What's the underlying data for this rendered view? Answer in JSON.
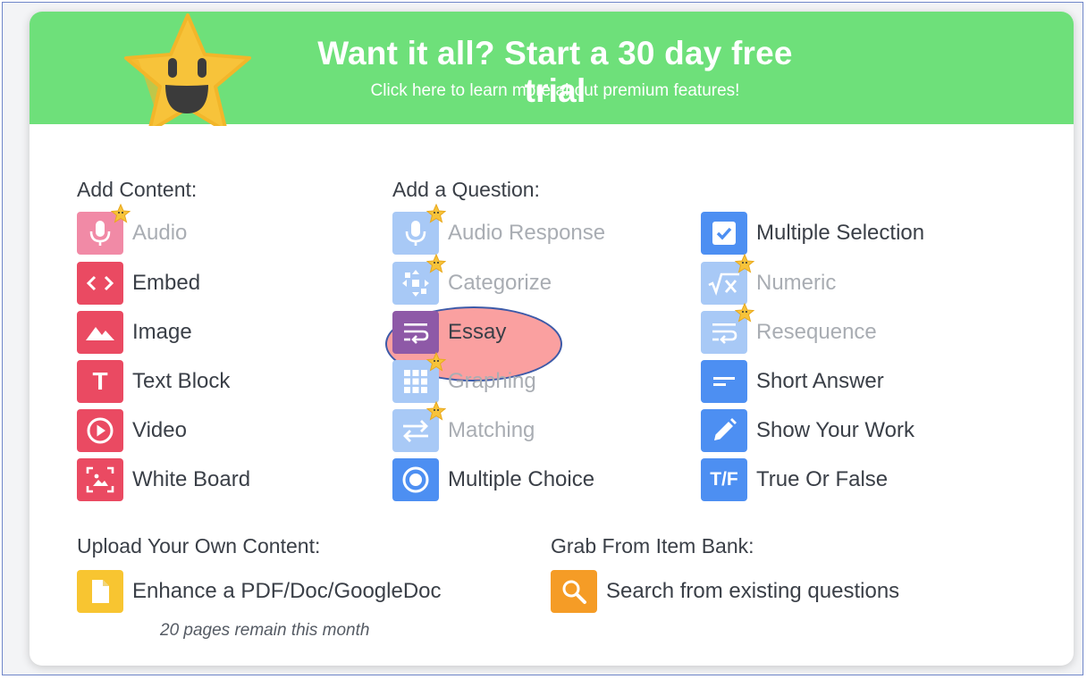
{
  "banner": {
    "title": "Want it all? Start a 30 day free trial",
    "subtitle": "Click here to learn more about premium features!"
  },
  "sections": {
    "add_content": "Add Content:",
    "add_question": "Add a Question:",
    "upload": "Upload Your Own Content:",
    "item_bank": "Grab From Item Bank:"
  },
  "content_items": [
    {
      "label": "Audio",
      "icon": "microphone-icon",
      "premium": true
    },
    {
      "label": "Embed",
      "icon": "code-icon",
      "premium": false
    },
    {
      "label": "Image",
      "icon": "mountain-icon",
      "premium": false
    },
    {
      "label": "Text Block",
      "icon": "text-t-icon",
      "premium": false
    },
    {
      "label": "Video",
      "icon": "play-circle-icon",
      "premium": false
    },
    {
      "label": "White Board",
      "icon": "whiteboard-icon",
      "premium": false
    }
  ],
  "question_items_col1": [
    {
      "label": "Audio Response",
      "icon": "microphone-icon",
      "premium": true
    },
    {
      "label": "Categorize",
      "icon": "categorize-icon",
      "premium": true
    },
    {
      "label": "Essay",
      "icon": "essay-icon",
      "premium": false
    },
    {
      "label": "Graphing",
      "icon": "grid-icon",
      "premium": true
    },
    {
      "label": "Matching",
      "icon": "arrows-swap-icon",
      "premium": true
    },
    {
      "label": "Multiple Choice",
      "icon": "radio-icon",
      "premium": false
    }
  ],
  "question_items_col2": [
    {
      "label": "Multiple Selection",
      "icon": "checkbox-icon",
      "premium": false
    },
    {
      "label": "Numeric",
      "icon": "sqrt-x-icon",
      "premium": true
    },
    {
      "label": "Resequence",
      "icon": "resequence-icon",
      "premium": true
    },
    {
      "label": "Short Answer",
      "icon": "short-answer-icon",
      "premium": false
    },
    {
      "label": "Show Your Work",
      "icon": "pencil-icon",
      "premium": false
    },
    {
      "label": "True Or False",
      "icon": "tf-icon",
      "premium": false
    }
  ],
  "tf_icon_text": "T/F",
  "text_icon_letter": "T",
  "upload": {
    "label": "Enhance a PDF/Doc/GoogleDoc",
    "note": "20 pages remain this month"
  },
  "item_bank": {
    "label": "Search from existing questions"
  },
  "colors": {
    "banner": "#6ee07a",
    "content_red": "#ea4a62",
    "question_blue": "#4d8ff2",
    "essay_purple": "#8e59a7",
    "highlight": "#f87878"
  }
}
